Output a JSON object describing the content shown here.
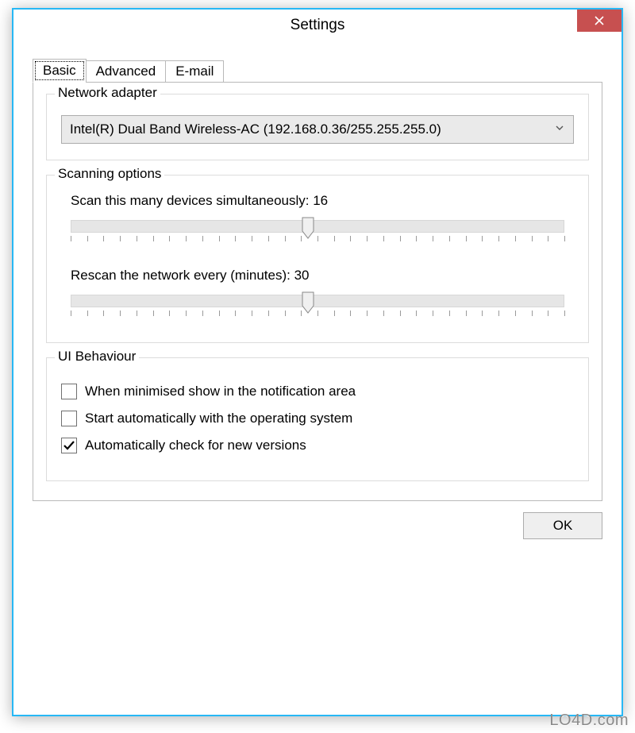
{
  "window": {
    "title": "Settings"
  },
  "tabs": [
    {
      "label": "Basic",
      "active": true
    },
    {
      "label": "Advanced",
      "active": false
    },
    {
      "label": "E-mail",
      "active": false
    }
  ],
  "group_network": {
    "legend": "Network adapter",
    "adapter_selected": "Intel(R) Dual Band Wireless-AC (192.168.0.36/255.255.255.0)"
  },
  "group_scan": {
    "legend": "Scanning options",
    "simul_label_prefix": "Scan this many devices simultaneously: ",
    "simul_value": "16",
    "simul_pos_pct": 48,
    "rescan_label_prefix": "Rescan the network every (minutes): ",
    "rescan_value": "30",
    "rescan_pos_pct": 48
  },
  "group_ui": {
    "legend": "UI Behaviour",
    "cb_tray": {
      "checked": false,
      "label": "When minimised show in the notification area"
    },
    "cb_startup": {
      "checked": false,
      "label": "Start automatically with the operating system"
    },
    "cb_update": {
      "checked": true,
      "label": "Automatically check for new versions"
    }
  },
  "buttons": {
    "ok": "OK"
  },
  "watermark": "LO4D.com"
}
